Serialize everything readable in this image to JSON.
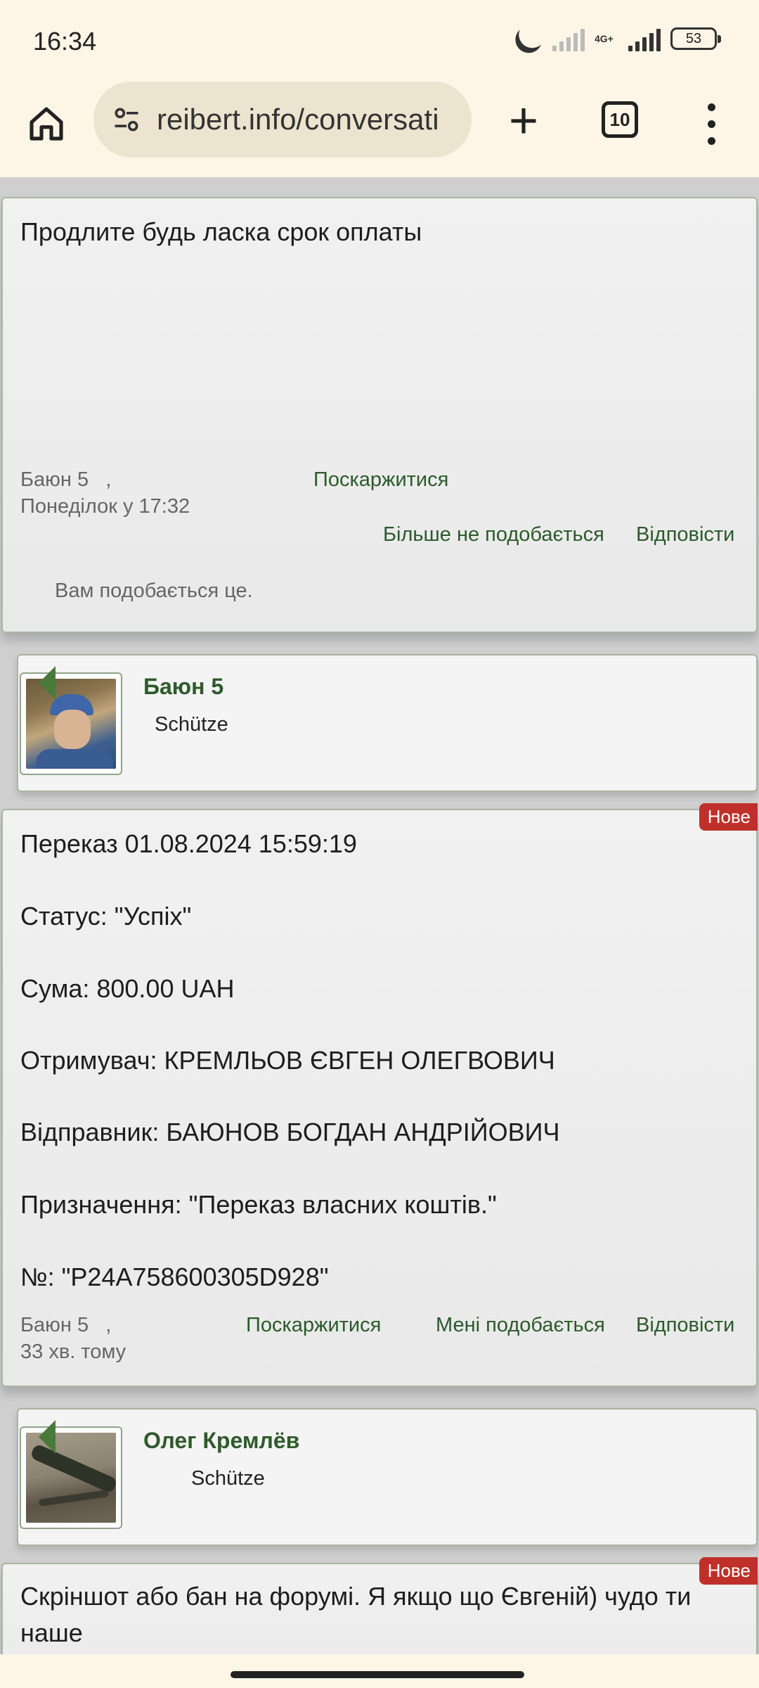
{
  "status_bar": {
    "time": "16:34",
    "network": "4G+",
    "battery": "53",
    "icons": [
      "moon-icon",
      "signal-icon",
      "signal-icon",
      "battery-icon"
    ]
  },
  "browser": {
    "url": "reibert.info/conversati",
    "tab_count": "10",
    "icons": [
      "home-icon",
      "site-settings-icon",
      "plus-icon",
      "tabs-icon",
      "more-vert-icon"
    ]
  },
  "messages": [
    {
      "lines": [
        "Продлите будь ласка срок оплаты"
      ],
      "author": "Баюн 5",
      "time": "Понеділок у 17:32",
      "report": "Поскаржитися",
      "like": "Більше не подобається",
      "reply": "Відповісти",
      "liked_note": "Вам подобається це."
    },
    {
      "badge": "Нове",
      "lines": [
        "Переказ 01.08.2024 15:59:19",
        "Статус: \"Успіх\"",
        "Сума: 800.00 UAH",
        "Отримувач: КРЕМЛЬОВ ЄВГЕН ОЛЕГВОВИЧ",
        "Відправник: БАЮНОВ БОГДАН АНДРІЙОВИЧ",
        "Призначення: \"Переказ власних коштів.\"",
        "№: \"P24A758600305D928\""
      ],
      "author": "Баюн 5",
      "time": "33 хв. тому",
      "report": "Поскаржитися",
      "like": "Мені подобається",
      "reply": "Відповісти"
    },
    {
      "badge": "Нове",
      "lines": [
        "Скріншот або бан на форумі. Я якщо що Євгеній) чудо ти",
        "наше"
      ]
    }
  ],
  "users": [
    {
      "name": "Баюн 5",
      "rank": "Schütze"
    },
    {
      "name": "Олег Кремлёв",
      "rank": "Schütze"
    }
  ],
  "colors": {
    "link_green": "#2b5a2b",
    "badge_red": "#c0302a",
    "chrome_bg": "#fdf6e7"
  }
}
